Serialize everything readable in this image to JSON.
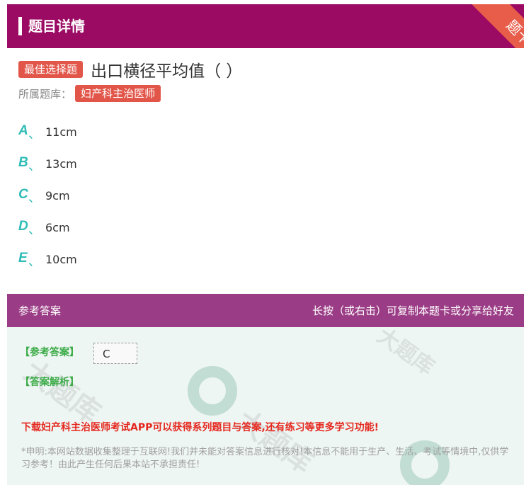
{
  "header": {
    "title": "题目详情",
    "ribbon_label": "题卡"
  },
  "question": {
    "type_tag": "最佳选择题",
    "text": "出口横径平均值（ ）",
    "bank_label": "所属题库：",
    "bank_name": "妇产科主治医师"
  },
  "options": [
    {
      "letter": "A",
      "sep": "、",
      "text": "11cm"
    },
    {
      "letter": "B",
      "sep": "、",
      "text": "13cm"
    },
    {
      "letter": "C",
      "sep": "、",
      "text": "9cm"
    },
    {
      "letter": "D",
      "sep": "、",
      "text": "6cm"
    },
    {
      "letter": "E",
      "sep": "、",
      "text": "10cm"
    }
  ],
  "answer_bar": {
    "left": "参考答案",
    "right": "长按（或右击）可复制本题卡或分享给好友"
  },
  "answer": {
    "ref_label": "【参考答案】",
    "ref_value": "C",
    "analysis_label": "【答案解析】",
    "download_text": "下载妇产科主治医师考试APP可以获得系列题目与答案,还有练习等更多学习功能!",
    "disclaimer": "*申明:本网站数据收集整理于互联网!我们并未能对答案信息进行核对!本信息不能用于生产、生活、考试等情境中,仅供学习参考！由此产生任何后果本站不承担责任!"
  },
  "colors": {
    "header_bg": "#9b0a63",
    "tag_red": "#e2564a",
    "option_letter": "#2fbcb6",
    "answer_bar_bg": "#9b3d86",
    "answer_bg": "#eef6f3",
    "label_green": "#3bab47",
    "download_red": "#e5281f"
  }
}
